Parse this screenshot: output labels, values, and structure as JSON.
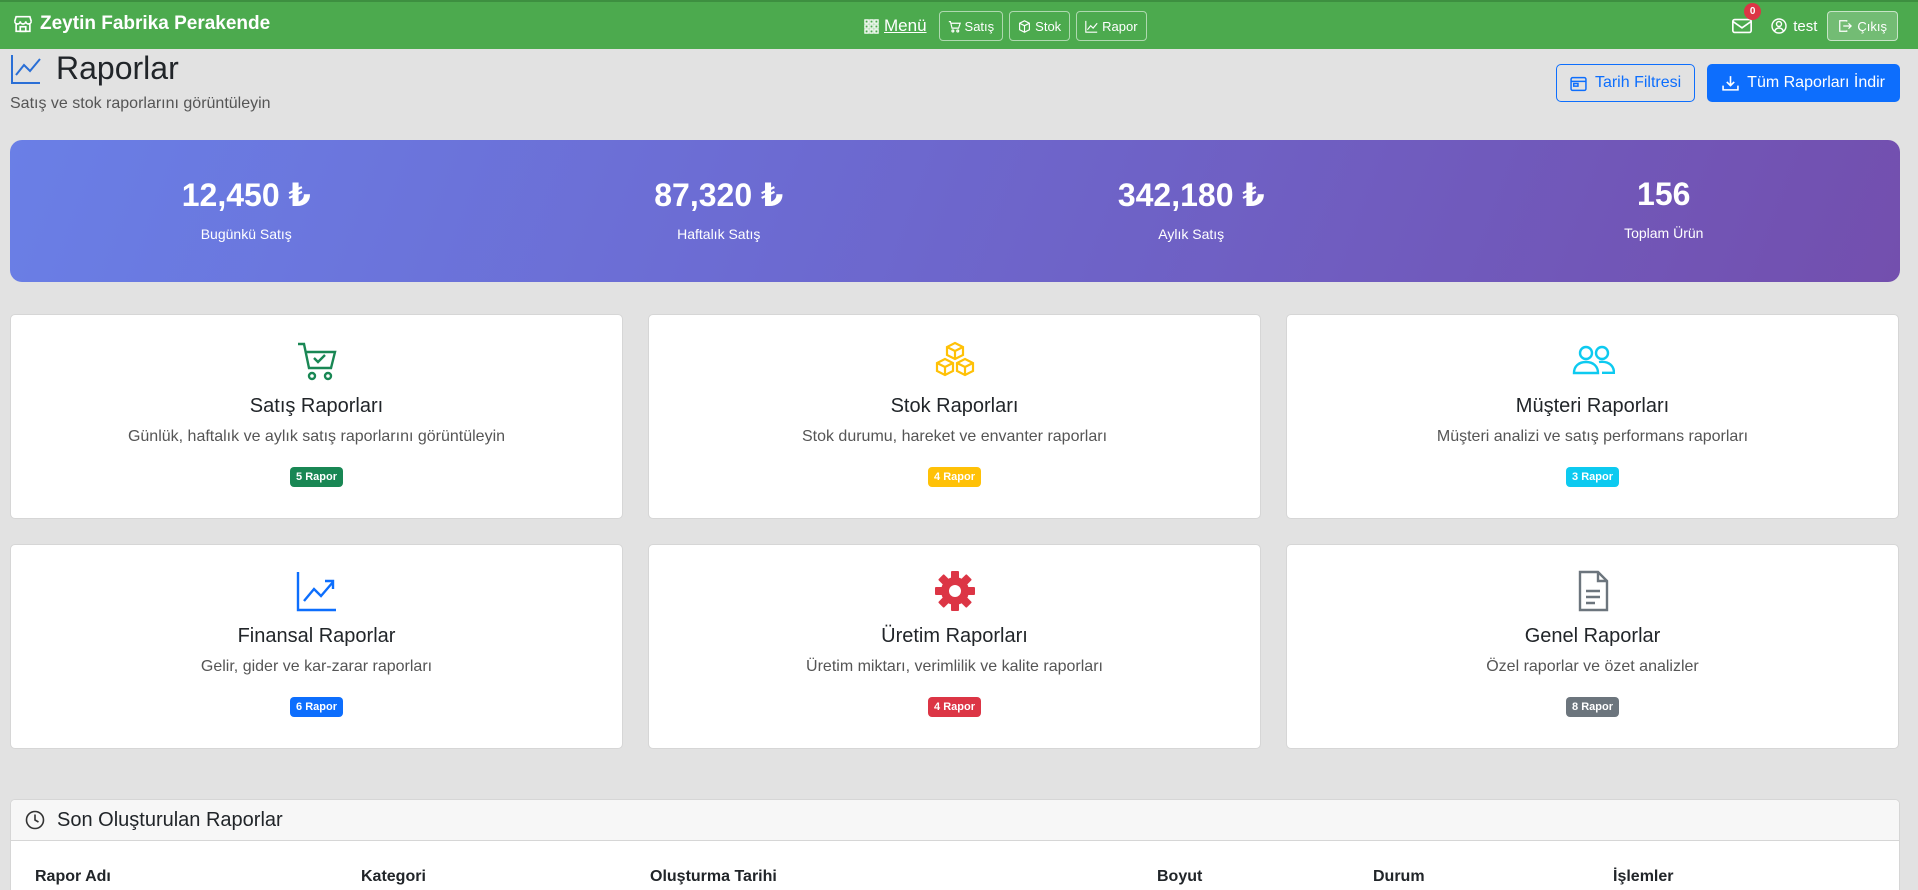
{
  "navbar": {
    "brand": "Zeytin Fabrika Perakende",
    "menu_label": "Menü",
    "buttons": [
      {
        "label": "Satış",
        "icon": "cart-icon"
      },
      {
        "label": "Stok",
        "icon": "box-icon"
      },
      {
        "label": "Rapor",
        "icon": "graph-icon"
      }
    ],
    "mail_count": "0",
    "user": "test",
    "logout_label": "Çıkış",
    "color": "#4caa4e"
  },
  "header": {
    "title": "Raporlar",
    "subtitle": "Satış ve stok raporlarını görüntüleyin",
    "date_filter_label": "Tarih Filtresi",
    "download_all_label": "Tüm Raporları İndir"
  },
  "stats": [
    {
      "value": "12,450 ₺",
      "label": "Bugünkü Satış"
    },
    {
      "value": "87,320 ₺",
      "label": "Haftalık Satış"
    },
    {
      "value": "342,180 ₺",
      "label": "Aylık Satış"
    },
    {
      "value": "156",
      "label": "Toplam Ürün"
    }
  ],
  "cards": [
    {
      "title": "Satış Raporları",
      "desc": "Günlük, haftalık ve aylık satış raporlarını görüntüleyin",
      "badge": "5 Rapor",
      "color": "#198754",
      "icon": "cart-check-icon"
    },
    {
      "title": "Stok Raporları",
      "desc": "Stok durumu, hareket ve envanter raporları",
      "badge": "4 Rapor",
      "color": "#ffc107",
      "icon": "boxes-icon"
    },
    {
      "title": "Müşteri Raporları",
      "desc": "Müşteri analizi ve satış performans raporları",
      "badge": "3 Rapor",
      "color": "#0dcaf0",
      "icon": "people-icon"
    },
    {
      "title": "Finansal Raporlar",
      "desc": "Gelir, gider ve kar-zarar raporları",
      "badge": "6 Rapor",
      "color": "#0d6efd",
      "icon": "trend-up-icon"
    },
    {
      "title": "Üretim Raporları",
      "desc": "Üretim miktarı, verimlilik ve kalite raporları",
      "badge": "4 Rapor",
      "color": "#dc3545",
      "icon": "gear-icon"
    },
    {
      "title": "Genel Raporlar",
      "desc": "Özel raporlar ve özet analizler",
      "badge": "8 Rapor",
      "color": "#6c757d",
      "icon": "document-icon"
    }
  ],
  "recent": {
    "title": "Son Oluşturulan Raporlar",
    "columns": [
      "Rapor Adı",
      "Kategori",
      "Oluşturma Tarihi",
      "Boyut",
      "Durum",
      "İşlemler"
    ]
  }
}
